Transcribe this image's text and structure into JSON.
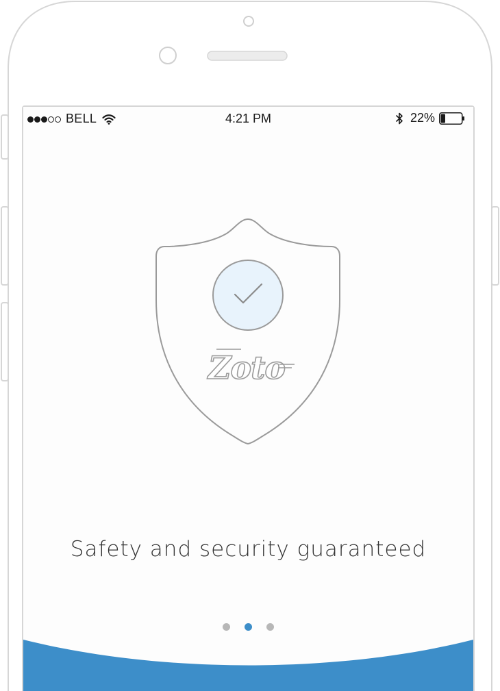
{
  "status_bar": {
    "signal_dots": [
      true,
      true,
      true,
      false,
      false
    ],
    "carrier": "BELL",
    "time": "4:21 PM",
    "battery_percent": "22%",
    "battery_level": 0.22,
    "icons": [
      "wifi-icon",
      "bluetooth-icon",
      "battery-icon"
    ]
  },
  "hero": {
    "logo_text": "Zoto",
    "icons": [
      "shield-icon",
      "checkmark-icon"
    ]
  },
  "tagline": "Safety and security guaranteed",
  "pager": {
    "count": 3,
    "active_index": 1
  },
  "colors": {
    "accent": "#3d8ec9",
    "check_circle_fill": "#e8f3fc",
    "outline": "#9a9a9a",
    "dot_inactive": "#b7b7b7"
  }
}
